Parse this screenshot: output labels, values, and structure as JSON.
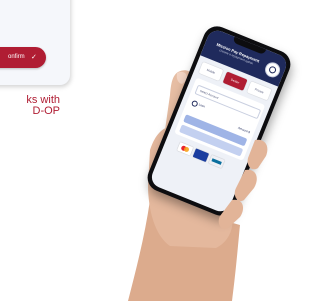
{
  "card": {
    "confirm_label": "onfirm",
    "confirm_check": "✓"
  },
  "caption": {
    "line1": "ks with",
    "line2": "D-OP"
  },
  "phone": {
    "title": "Mission Pay Repayment",
    "subtitle": "choose a repayment option",
    "tabs": [
      "Mobile",
      "Dealer",
      "Private"
    ],
    "row1_label": "Select Account",
    "row2_label": "Loan",
    "row2_amount": "Amount $",
    "payment_cards": [
      "mastercard-icon",
      "visa-icon",
      "maestro-icon"
    ]
  },
  "colors": {
    "brand_red": "#b01d33",
    "navy": "#1f2a5c",
    "bar_blue": "#9fb4e6",
    "skin": "#e4b89d"
  }
}
